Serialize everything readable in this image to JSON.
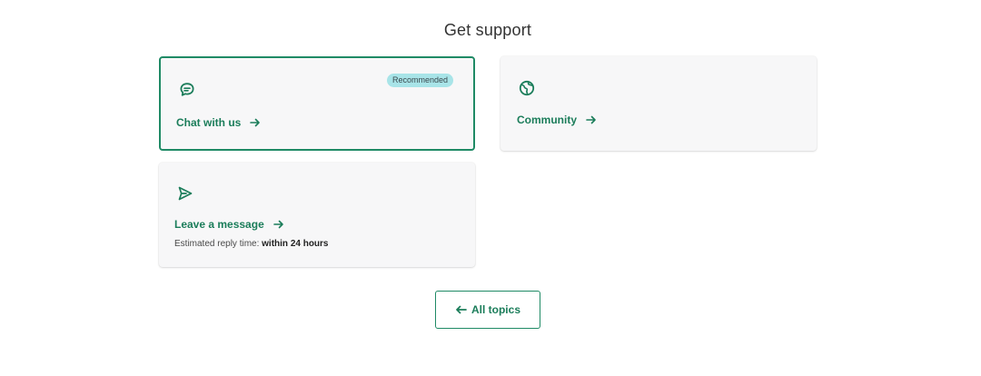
{
  "page": {
    "title": "Get support"
  },
  "colors": {
    "accent": "#1b7d5a",
    "badge_bg": "#a8e4e8",
    "card_bg": "#f7f7f8"
  },
  "cards": {
    "chat": {
      "label": "Chat with us",
      "badge": "Recommended",
      "icon": "chat-bubble-icon"
    },
    "community": {
      "label": "Community",
      "icon": "globe-icon"
    },
    "message": {
      "label": "Leave a message",
      "icon": "send-icon",
      "reply_label": "Estimated reply time:",
      "reply_value": "within 24 hours"
    }
  },
  "footer": {
    "all_topics_label": "All topics",
    "icon": "arrow-left-icon"
  }
}
